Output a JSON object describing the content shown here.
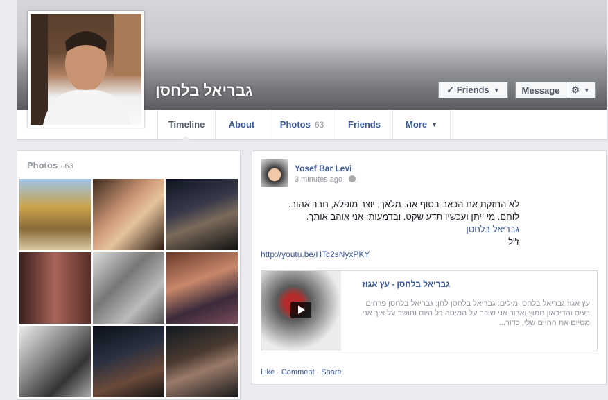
{
  "profile": {
    "name": "גבריאל בלחסן",
    "friends_button": "✓ Friends",
    "message_button": "Message",
    "settings_button": "⚙"
  },
  "nav": {
    "tabs": [
      "Timeline",
      "About",
      "Photos",
      "Friends",
      "More"
    ],
    "photos_count": "63"
  },
  "photos_panel": {
    "title": "Photos",
    "count": "· 63"
  },
  "post": {
    "author": "Yosef Bar Levi",
    "time": "3 minutes ago",
    "line1": "לא החזקת את הכאב בסוף אה. מלאך, יוצר מופלא, חבר אהוב.",
    "line2": "לוחם. מי ייתן ועכשיו תדע שקט. ובדמעות: אני אוהב אותך.",
    "tag": "גבריאל בלחסן",
    "line4": "ז\"ל",
    "link": "http://youtu.be/HTc2sNyxPKY",
    "shared_title": "גבריאל בלחסן - עץ אגוז",
    "shared_desc": "עץ אגוז גבריאל בלחסן מילים: גבריאל בלחסן לחן: גבריאל בלחסן פרחים רעים והדיכאון חמוץ וארור אני שוכב על המיטה כל היום וחושב על איך אני מסיים את החיים שלי, כדור...",
    "actions": [
      "Like",
      "Comment",
      "Share"
    ]
  },
  "colors": {
    "link": "#3b5998",
    "muted": "#90949c",
    "border": "#d3d6db"
  }
}
